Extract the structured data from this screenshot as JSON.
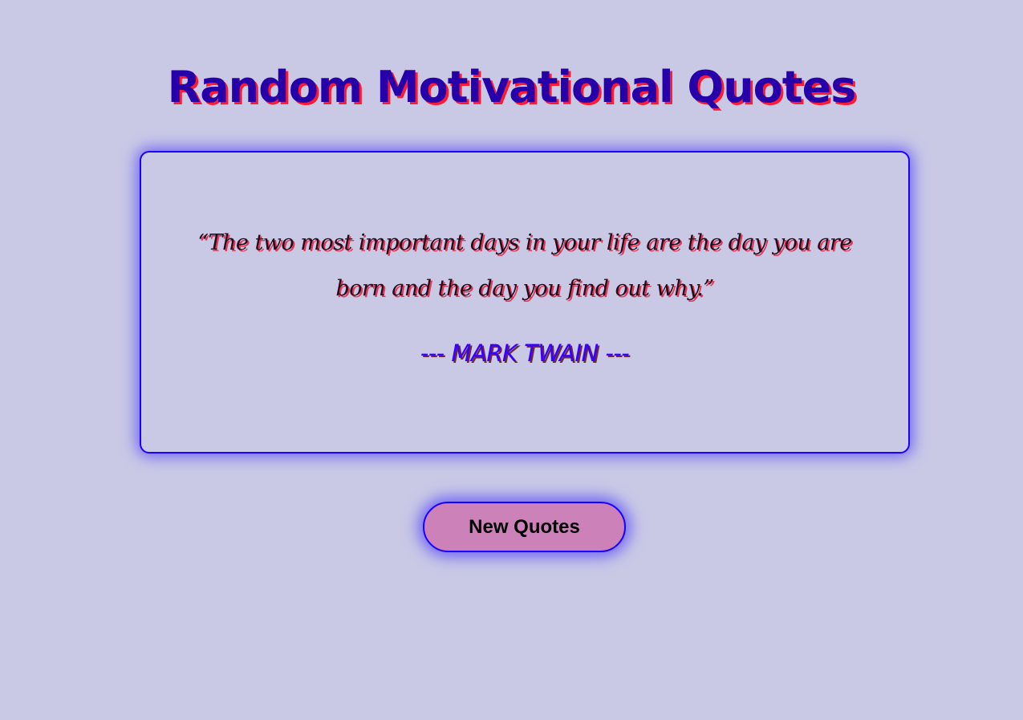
{
  "header": {
    "title": "Random Motivational Quotes"
  },
  "quote": {
    "text": "“The two most important days in your life are the day you are born and the day you find out why.”",
    "author": "--- MARK TWAIN ---"
  },
  "actions": {
    "new_quote_label": "New Quotes"
  },
  "colors": {
    "background": "#c9c9e6",
    "title": "#2600a8",
    "title_shadow": "#ff1a33",
    "card_border": "#1a00ff",
    "quote_text": "#2a0a1a",
    "author_text": "#3a00ff",
    "button_fill": "#cc82b9"
  }
}
